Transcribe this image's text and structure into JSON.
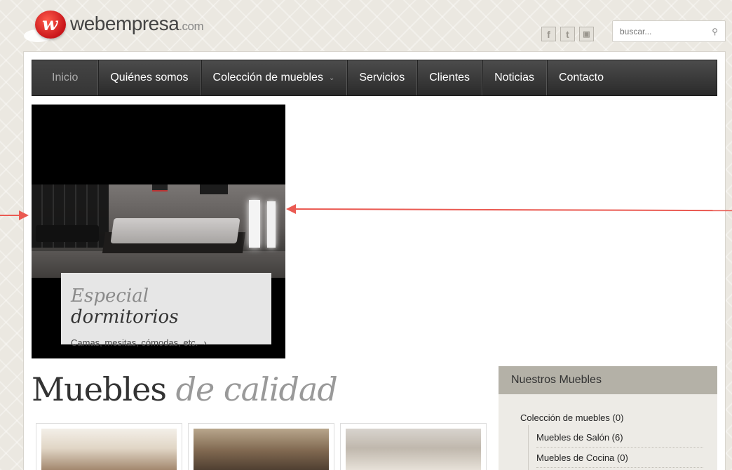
{
  "header": {
    "logo_text": "webempresa",
    "logo_domain": ".com",
    "search_placeholder": "buscar..."
  },
  "social": [
    {
      "icon": "facebook-icon",
      "glyph": "f"
    },
    {
      "icon": "twitter-icon",
      "glyph": "t"
    },
    {
      "icon": "lock-icon",
      "glyph": "🔒"
    }
  ],
  "nav": {
    "items": [
      {
        "label": "Inicio"
      },
      {
        "label": "Quiénes somos"
      },
      {
        "label": "Colección de muebles"
      },
      {
        "label": "Servicios"
      },
      {
        "label": "Clientes"
      },
      {
        "label": "Noticias"
      },
      {
        "label": "Contacto"
      }
    ]
  },
  "slide": {
    "title_light": "Especial",
    "title_dark": "dormitorios",
    "subtitle": "Camas, mesitas, cómodas, etc.",
    "arrow": "›"
  },
  "main": {
    "title_dark": "Muebles",
    "title_light": "de calidad"
  },
  "sidebar": {
    "title": "Nuestros Muebles",
    "category": "Colección de muebles (0)",
    "subcategories": [
      "Muebles de Salón (6)",
      "Muebles de Cocina (0)"
    ]
  },
  "colors": {
    "nav_bg": "#333333",
    "annotation_red": "#ea5a52",
    "sidebar_header": "#b4b1a7"
  }
}
